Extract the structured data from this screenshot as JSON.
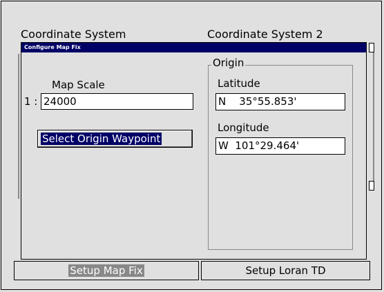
{
  "background": {
    "left_label": "Coordinate System",
    "right_label": "Coordinate System 2"
  },
  "dialog": {
    "title": "Configure Map Fix",
    "map_scale": {
      "label": "Map Scale",
      "prefix": "1 :",
      "value": "24000"
    },
    "select_origin_button": "Select Origin Waypoint",
    "origin": {
      "legend": "Origin",
      "latitude_label": "Latitude",
      "latitude_value": "N    35°55.853'",
      "longitude_label": "Longitude",
      "longitude_value": "W  101°29.464'"
    }
  },
  "tabs": [
    {
      "label": "Setup Map Fix",
      "active": true
    },
    {
      "label": "Setup Loran TD",
      "active": false
    }
  ],
  "colors": {
    "titlebar": "#000066",
    "background": "#e0e0e0",
    "highlight": "#000066"
  }
}
